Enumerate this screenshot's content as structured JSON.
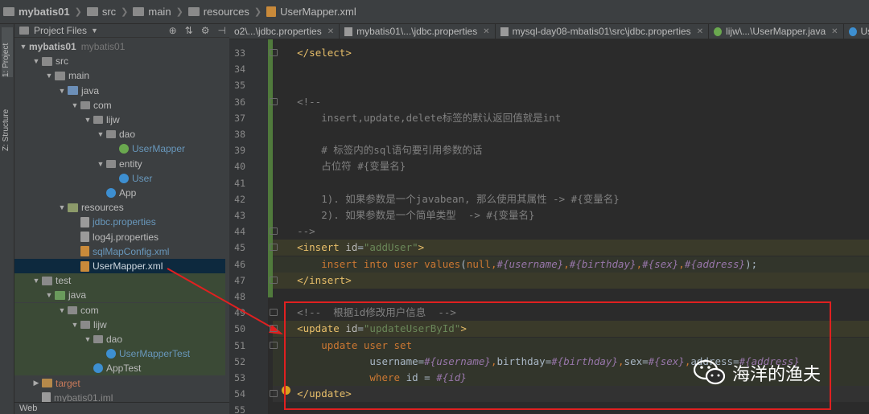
{
  "breadcrumb": {
    "items": [
      "mybatis01",
      "src",
      "main",
      "resources",
      "UserMapper.xml"
    ]
  },
  "left_strip": {
    "project_tab": "1: Project",
    "structure_tab": "Z: Structure"
  },
  "project_panel": {
    "title": "Project Files",
    "dropdown_icon": "chevron-down-icon",
    "toolbar_icons": [
      "target-icon",
      "collapse-icon",
      "gear-icon",
      "hide-icon"
    ],
    "tree": [
      {
        "label": "mybatis01",
        "extra": "mybatis01",
        "indent": 0,
        "icon": "project",
        "arrow": "down",
        "bold": true
      },
      {
        "label": "src",
        "indent": 1,
        "icon": "folder",
        "arrow": "down"
      },
      {
        "label": "main",
        "indent": 2,
        "icon": "folder",
        "arrow": "down"
      },
      {
        "label": "java",
        "indent": 3,
        "icon": "src",
        "arrow": "down"
      },
      {
        "label": "com",
        "indent": 4,
        "icon": "pkg",
        "arrow": "down"
      },
      {
        "label": "lijw",
        "indent": 5,
        "icon": "pkg",
        "arrow": "down"
      },
      {
        "label": "dao",
        "indent": 6,
        "icon": "pkg",
        "arrow": "down"
      },
      {
        "label": "UserMapper",
        "indent": 7,
        "icon": "iface",
        "color": "blue"
      },
      {
        "label": "entity",
        "indent": 6,
        "icon": "pkg",
        "arrow": "down"
      },
      {
        "label": "User",
        "indent": 7,
        "icon": "cls",
        "color": "blue"
      },
      {
        "label": "App",
        "indent": 6,
        "icon": "cls"
      },
      {
        "label": "resources",
        "indent": 3,
        "icon": "res",
        "arrow": "down"
      },
      {
        "label": "jdbc.properties",
        "indent": 4,
        "icon": "props",
        "color": "blue"
      },
      {
        "label": "log4j.properties",
        "indent": 4,
        "icon": "props"
      },
      {
        "label": "sqlMapConfig.xml",
        "indent": 4,
        "icon": "xmlf",
        "color": "blue"
      },
      {
        "label": "UserMapper.xml",
        "indent": 4,
        "icon": "xmlf",
        "color": "blue",
        "selected": true
      },
      {
        "label": "test",
        "indent": 1,
        "icon": "folder",
        "arrow": "down",
        "green": true
      },
      {
        "label": "java",
        "indent": 2,
        "icon": "test",
        "arrow": "down",
        "green": true
      },
      {
        "label": "com",
        "indent": 3,
        "icon": "pkg",
        "arrow": "down",
        "green": true
      },
      {
        "label": "lijw",
        "indent": 4,
        "icon": "pkg",
        "arrow": "down",
        "green": true
      },
      {
        "label": "dao",
        "indent": 5,
        "icon": "pkg",
        "arrow": "down",
        "green": true
      },
      {
        "label": "UserMapperTest",
        "indent": 6,
        "icon": "cls",
        "color": "blue",
        "green": true
      },
      {
        "label": "AppTest",
        "indent": 5,
        "icon": "cls",
        "green": true
      },
      {
        "label": "target",
        "indent": 1,
        "icon": "target",
        "arrow": "right",
        "color": "red"
      },
      {
        "label": "mybatis01.iml",
        "indent": 1,
        "icon": "props",
        "color": "gray"
      }
    ]
  },
  "bottom_panel": {
    "label": "Web"
  },
  "tabs": [
    {
      "label": "o2\\...\\jdbc.properties",
      "icon": "props-icon"
    },
    {
      "label": "mybatis01\\...\\jdbc.properties",
      "icon": "props-icon"
    },
    {
      "label": "mysql-day08-mbatis01\\src\\jdbc.properties",
      "icon": "props-icon"
    },
    {
      "label": "lijw\\...\\UserMapper.java",
      "icon": "interface-icon"
    },
    {
      "label": "User.java",
      "icon": "class-icon"
    }
  ],
  "editor": {
    "line_numbers": [
      "33",
      "34",
      "35",
      "36",
      "37",
      "38",
      "39",
      "40",
      "41",
      "42",
      "43",
      "44",
      "45",
      "46",
      "47",
      "48",
      "49",
      "50",
      "51",
      "52",
      "53",
      "54",
      "55"
    ],
    "lines": [
      [
        {
          "t": "    ",
          "c": "pl"
        },
        {
          "t": "</",
          "c": "tag"
        },
        {
          "t": "select",
          "c": "tag"
        },
        {
          "t": ">",
          "c": "tag"
        }
      ],
      [],
      [],
      [
        {
          "t": "    <!--",
          "c": "cmt"
        }
      ],
      [
        {
          "t": "        insert,update,delete标签的默认返回值就是int",
          "c": "cmt"
        }
      ],
      [],
      [
        {
          "t": "        # 标签内的sql语句要引用参数的话",
          "c": "cmt"
        }
      ],
      [
        {
          "t": "        占位符 #{变量名}",
          "c": "cmt"
        }
      ],
      [],
      [
        {
          "t": "        1). 如果参数是一个javabean, 那么使用其属性 -> #{变量名}",
          "c": "cmt"
        }
      ],
      [
        {
          "t": "        2). 如果参数是一个简单类型  -> #{变量名}",
          "c": "cmt"
        }
      ],
      [
        {
          "t": "    -->",
          "c": "cmt"
        }
      ],
      [
        {
          "t": "    <insert ",
          "c": "tag"
        },
        {
          "t": "id",
          "c": "attr"
        },
        {
          "t": "=",
          "c": "pl"
        },
        {
          "t": "\"addUser\"",
          "c": "val"
        },
        {
          "t": ">",
          "c": "tag"
        }
      ],
      [
        {
          "t": "        insert into user values",
          "c": "kw"
        },
        {
          "t": "(",
          "c": "pl"
        },
        {
          "t": "null",
          "c": "kw"
        },
        {
          "t": ",",
          "c": "kw"
        },
        {
          "t": "#{username}",
          "c": "var"
        },
        {
          "t": ",",
          "c": "kw"
        },
        {
          "t": "#{birthday}",
          "c": "var"
        },
        {
          "t": ",",
          "c": "kw"
        },
        {
          "t": "#{sex}",
          "c": "var"
        },
        {
          "t": ",",
          "c": "kw"
        },
        {
          "t": "#{address}",
          "c": "var"
        },
        {
          "t": ");",
          "c": "pl"
        }
      ],
      [
        {
          "t": "    </insert>",
          "c": "tag"
        }
      ],
      [],
      [
        {
          "t": "    <!--  根据id修改用户信息  -->",
          "c": "cmt"
        }
      ],
      [
        {
          "t": "    <update ",
          "c": "tag"
        },
        {
          "t": "id",
          "c": "attr"
        },
        {
          "t": "=",
          "c": "pl"
        },
        {
          "t": "\"updateUserById\"",
          "c": "val"
        },
        {
          "t": ">",
          "c": "tag"
        }
      ],
      [
        {
          "t": "        update user set",
          "c": "kw"
        }
      ],
      [
        {
          "t": "                username=",
          "c": "pl"
        },
        {
          "t": "#{username}",
          "c": "var"
        },
        {
          "t": ",",
          "c": "kw"
        },
        {
          "t": "birthday=",
          "c": "pl"
        },
        {
          "t": "#{birthday}",
          "c": "var"
        },
        {
          "t": ",",
          "c": "kw"
        },
        {
          "t": "sex=",
          "c": "pl"
        },
        {
          "t": "#{sex}",
          "c": "var"
        },
        {
          "t": ",",
          "c": "kw"
        },
        {
          "t": "address=",
          "c": "pl"
        },
        {
          "t": "#{address}",
          "c": "var"
        }
      ],
      [
        {
          "t": "                where ",
          "c": "kw"
        },
        {
          "t": "id = ",
          "c": "pl"
        },
        {
          "t": "#{id}",
          "c": "var"
        }
      ],
      [
        {
          "t": "    </update>",
          "c": "tag"
        }
      ],
      []
    ]
  },
  "watermark": {
    "text": "海洋的渔夫",
    "icon": "wechat-icon"
  },
  "colors": {
    "accent_red": "#e02020",
    "tag": "#e8bf6a",
    "keyword": "#cc7832",
    "string": "#6a8759",
    "variable": "#9876aa",
    "comment": "#808080"
  }
}
